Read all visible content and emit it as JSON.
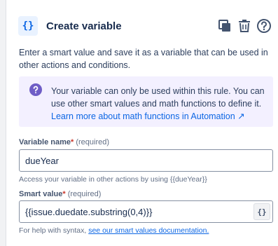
{
  "header": {
    "title": "Create variable",
    "icon_glyph": "{}"
  },
  "description": "Enter a smart value and save it as a variable that can be used in other actions and conditions.",
  "info": {
    "text": "Your variable can only be used within this rule. You can use other smart values and math functions to define it. ",
    "link_text": "Learn more about math functions in Automation ↗"
  },
  "fields": {
    "variable_name": {
      "label": "Variable name",
      "required_mark": "*",
      "required_note": "(required)",
      "value": "dueYear",
      "helper": "Access your variable in other actions by using {{dueYear}}"
    },
    "smart_value": {
      "label": "Smart value",
      "required_mark": "*",
      "required_note": "(required)",
      "value": "{{issue.duedate.substring(0,4)}}",
      "button_glyph": "{}",
      "helper_prefix": "For help with syntax, ",
      "helper_link": "see our smart values documentation."
    }
  },
  "colors": {
    "accent": "#0c66e4",
    "info_bg": "#f3f0ff",
    "info_icon": "#6e5dc6",
    "required": "#c9372c"
  }
}
